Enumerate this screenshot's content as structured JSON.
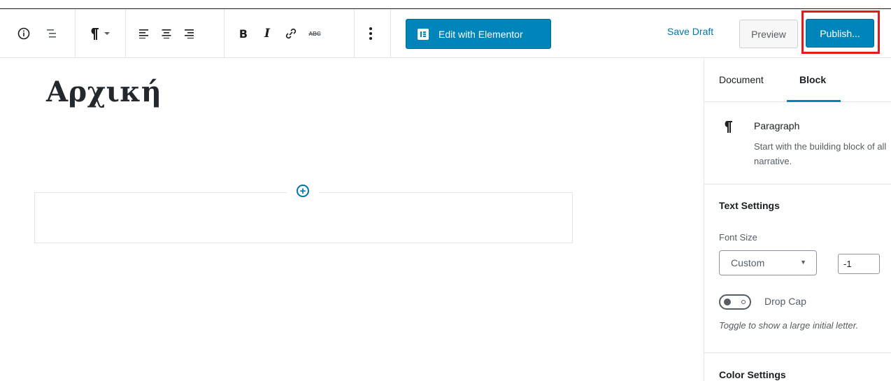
{
  "toolbar": {
    "icons": [
      "info-icon",
      "outline-icon",
      "paragraph-icon",
      "align-left-icon",
      "align-center-icon",
      "align-right-icon",
      "bold-icon",
      "italic-icon",
      "link-icon",
      "strikethrough-icon",
      "more-options-icon"
    ],
    "strikethrough_text": "ABC",
    "elementor_label": "Edit with Elementor",
    "save_draft_label": "Save Draft",
    "preview_label": "Preview",
    "publish_label": "Publish..."
  },
  "editor": {
    "title": "Αρχική",
    "inserter_symbol": "+"
  },
  "sidebar": {
    "tabs": [
      "Document",
      "Block"
    ],
    "active_tab": "Block",
    "block_card": {
      "icon": "paragraph-icon",
      "title": "Paragraph",
      "description": "Start with the building block of all narrative."
    },
    "text_settings": {
      "heading": "Text Settings",
      "font_size_label": "Font Size",
      "font_size_value": "Custom",
      "custom_size_value": "-1",
      "drop_cap_label": "Drop Cap",
      "drop_cap_enabled": false,
      "drop_cap_help": "Toggle to show a large initial letter."
    },
    "color_settings": {
      "heading": "Color Settings"
    }
  },
  "colors": {
    "primary": "#0085ba",
    "link": "#0073aa",
    "highlight": "#e01b1b"
  }
}
